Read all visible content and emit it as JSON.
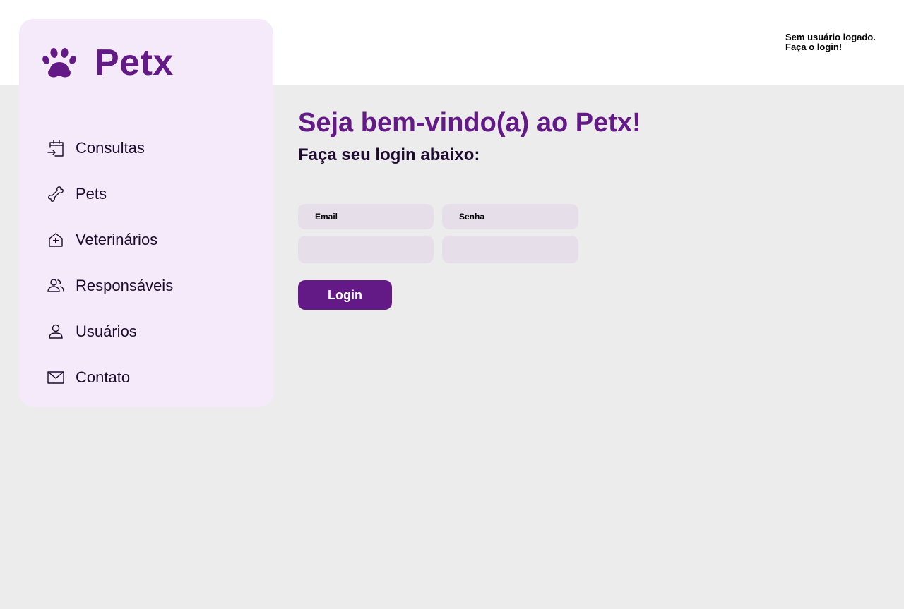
{
  "header": {
    "status_line1": "Sem usuário logado.",
    "status_line2": "Faça o login!"
  },
  "sidebar": {
    "brand": "Petx",
    "brand_icon": "paw-icon",
    "items": [
      {
        "label": "Consultas",
        "icon": "calendar-enter-icon"
      },
      {
        "label": "Pets",
        "icon": "bone-icon"
      },
      {
        "label": "Veterinários",
        "icon": "house-medical-icon"
      },
      {
        "label": "Responsáveis",
        "icon": "users-icon"
      },
      {
        "label": "Usuários",
        "icon": "user-icon"
      },
      {
        "label": "Contato",
        "icon": "envelope-icon"
      }
    ]
  },
  "main": {
    "title": "Seja bem-vindo(a) ao Petx!",
    "subtitle": "Faça seu login abaixo:"
  },
  "form": {
    "email_label": "Email",
    "email_value": "",
    "password_label": "Senha",
    "password_value": "",
    "submit_label": "Login"
  },
  "colors": {
    "accent": "#641a86",
    "sidebar_bg": "#f4eafa",
    "page_bg": "#ececec",
    "field_bg": "#e6dfea",
    "text_dark": "#1d0a2e"
  }
}
